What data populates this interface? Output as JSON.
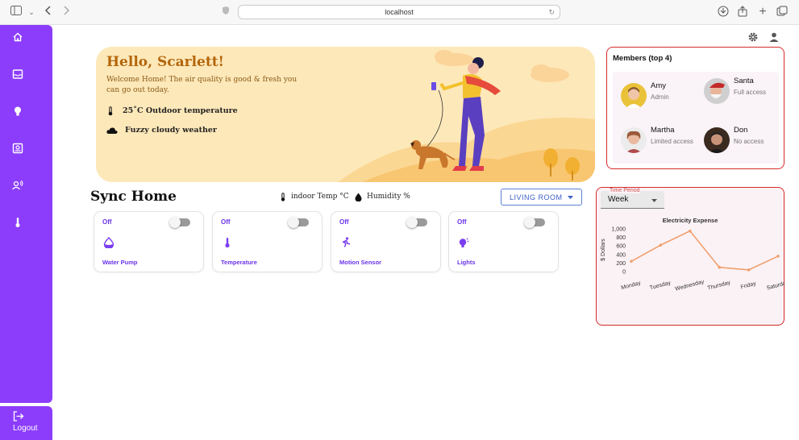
{
  "browser": {
    "address": "localhost"
  },
  "sidebar": {
    "items": [
      {
        "icon": "home-icon"
      },
      {
        "icon": "inbox-icon"
      },
      {
        "icon": "lightbulb-icon"
      },
      {
        "icon": "device-icon"
      },
      {
        "icon": "users-icon"
      },
      {
        "icon": "thermometer-icon"
      }
    ],
    "logout_label": "Logout"
  },
  "hero": {
    "title": "Hello, Scarlett!",
    "subtitle": "Welcome Home! The air quality is good & fresh you can go out today.",
    "temperature": "25˚C  Outdoor temperature",
    "weather": "Fuzzy cloudy weather"
  },
  "sync": {
    "title": "Sync Home",
    "indoor_temp": "indoor Temp °C",
    "humidity": "Humidity %",
    "room_select": "LIVING ROOM"
  },
  "devices": [
    {
      "state": "Off",
      "name": "Water Pump",
      "icon": "water-drop-icon"
    },
    {
      "state": "Off",
      "name": "Temperature",
      "icon": "thermometer-icon"
    },
    {
      "state": "Off",
      "name": "Motion Sensor",
      "icon": "running-person-icon"
    },
    {
      "state": "Off",
      "name": "Lights",
      "icon": "lightbulb-icon"
    }
  ],
  "members": {
    "title": "Members (top 4)",
    "list": [
      {
        "name": "Amy",
        "role": "Admin"
      },
      {
        "name": "Santa",
        "role": "Full access"
      },
      {
        "name": "Martha",
        "role": "Limited access"
      },
      {
        "name": "Don",
        "role": "No access"
      }
    ]
  },
  "period": {
    "label": "Time Period",
    "value": "Week"
  },
  "chart_data": {
    "type": "line",
    "title": "Electricity Expense",
    "ylabel": "$ Dollars",
    "xlabel": "",
    "categories": [
      "Monday",
      "Tuesday",
      "Wednesday",
      "Thursday",
      "Friday",
      "Saturday"
    ],
    "values": [
      240,
      620,
      950,
      100,
      40,
      360
    ],
    "ylim": [
      0,
      1000
    ],
    "yticks": [
      "0",
      "200",
      "400",
      "600",
      "800",
      "1,000"
    ],
    "color": "#f0a070"
  }
}
